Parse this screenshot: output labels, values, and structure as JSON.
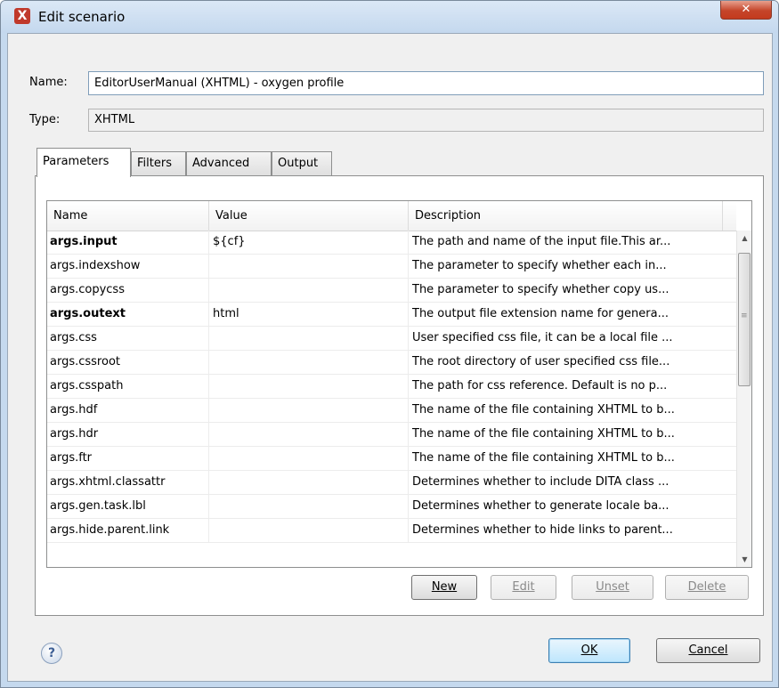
{
  "window": {
    "title": "Edit scenario",
    "app_icon": "X"
  },
  "form": {
    "name_label": "Name:",
    "name_value": "EditorUserManual (XHTML) - oxygen profile",
    "type_label": "Type:",
    "type_value": "XHTML"
  },
  "tabs": [
    "Parameters",
    "Filters",
    "Advanced",
    "Output"
  ],
  "table": {
    "headers": [
      "Name",
      "Value",
      "Description"
    ],
    "rows": [
      {
        "name": "args.input",
        "value": "${cf}",
        "desc": "The path and name of the input file.This ar...",
        "bold": true
      },
      {
        "name": "args.indexshow",
        "value": "",
        "desc": "The parameter to specify whether each in...",
        "bold": false
      },
      {
        "name": "args.copycss",
        "value": "",
        "desc": "The parameter to specify whether copy us...",
        "bold": false
      },
      {
        "name": "args.outext",
        "value": "html",
        "desc": "The output file extension name for genera...",
        "bold": true
      },
      {
        "name": "args.css",
        "value": "",
        "desc": "User specified css file, it can be a local file ...",
        "bold": false
      },
      {
        "name": "args.cssroot",
        "value": "",
        "desc": "The root directory of user specified css file...",
        "bold": false
      },
      {
        "name": "args.csspath",
        "value": "",
        "desc": "The path for css reference. Default is no p...",
        "bold": false
      },
      {
        "name": "args.hdf",
        "value": "",
        "desc": "The name of the file containing XHTML to b...",
        "bold": false
      },
      {
        "name": "args.hdr",
        "value": "",
        "desc": "The name of the file containing XHTML to b...",
        "bold": false
      },
      {
        "name": "args.ftr",
        "value": "",
        "desc": "The name of the file containing XHTML to b...",
        "bold": false
      },
      {
        "name": "args.xhtml.classattr",
        "value": "",
        "desc": "Determines whether to include DITA class ...",
        "bold": false
      },
      {
        "name": "args.gen.task.lbl",
        "value": "",
        "desc": "Determines whether to generate locale ba...",
        "bold": false
      },
      {
        "name": "args.hide.parent.link",
        "value": "",
        "desc": "Determines whether to hide links to parent...",
        "bold": false
      }
    ]
  },
  "table_buttons": {
    "new": "New",
    "edit": "Edit",
    "unset": "Unset",
    "delete": "Delete"
  },
  "dialog_buttons": {
    "ok": "OK",
    "cancel": "Cancel"
  },
  "help": "?"
}
